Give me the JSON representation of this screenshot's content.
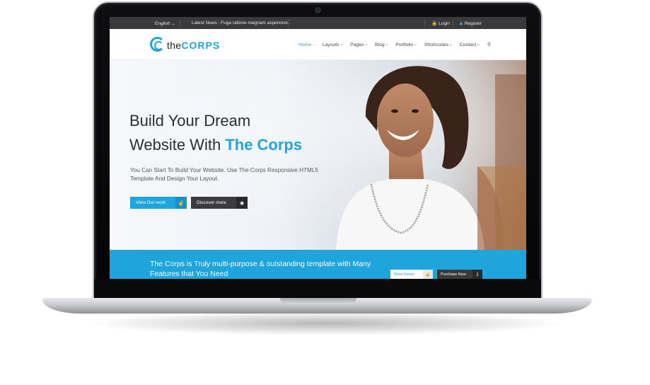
{
  "topbar": {
    "language": "English",
    "news": "Latest News : Fuga ratione magnam asperiores.",
    "login": "Login",
    "register": "Register"
  },
  "logo": {
    "part1": "the",
    "part2": "CORPS"
  },
  "menu": {
    "items": [
      {
        "label": "Home"
      },
      {
        "label": "Layouts"
      },
      {
        "label": "Pages"
      },
      {
        "label": "Blog"
      },
      {
        "label": "Portfolio"
      },
      {
        "label": "Shortcodes"
      },
      {
        "label": "Contact"
      }
    ]
  },
  "hero": {
    "title_line1": "Build Your Dream",
    "title_line2_prefix": "Website With",
    "title_line2_accent": "The Corps",
    "description": "You Can Start To Build Your Website. Use The Corps Responsive HTML5 Template And Design Your Layout.",
    "btn_primary": "View Our work",
    "btn_secondary": "Discover more"
  },
  "promo": {
    "text": "The Corps is Truly multi-purpose & outstanding template with Many Features that You Need",
    "btn_demo": "More Demo",
    "btn_purchase": "Purchase Now"
  },
  "colors": {
    "accent": "#1fa4dc",
    "topbar": "#3a3a3d"
  },
  "icons": [
    "webcam-icon",
    "lock-icon",
    "user-icon",
    "search-icon",
    "thumbs-up-icon",
    "eye-icon",
    "download-icon"
  ]
}
